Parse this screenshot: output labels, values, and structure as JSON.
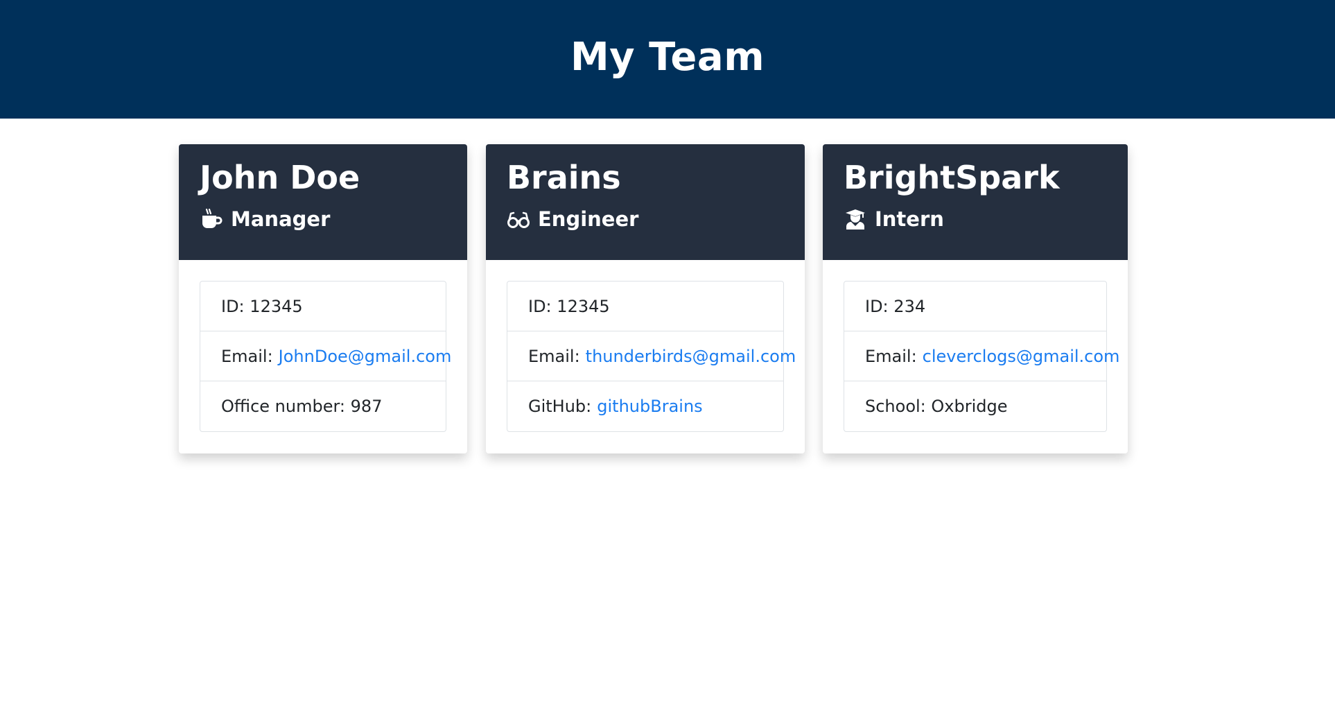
{
  "page_title": "My Team",
  "colors": {
    "header_bg": "#00305a",
    "card_header_bg": "#252f3f",
    "link": "#1a7cf0"
  },
  "cards": [
    {
      "name": "John Doe",
      "role": "Manager",
      "icon": "coffee-mug-icon",
      "rows": [
        {
          "label": "ID:",
          "value": "12345"
        },
        {
          "label": "Email:",
          "value": "JohnDoe@gmail.com",
          "link": true
        },
        {
          "label": "Office number:",
          "value": "987"
        }
      ]
    },
    {
      "name": "Brains",
      "role": "Engineer",
      "icon": "glasses-icon",
      "rows": [
        {
          "label": "ID:",
          "value": "12345"
        },
        {
          "label": "Email:",
          "value": "thunderbirds@gmail.com",
          "link": true
        },
        {
          "label": "GitHub:",
          "value": "githubBrains",
          "link": true
        }
      ]
    },
    {
      "name": "BrightSpark",
      "role": "Intern",
      "icon": "graduate-icon",
      "rows": [
        {
          "label": "ID:",
          "value": "234"
        },
        {
          "label": "Email:",
          "value": "cleverclogs@gmail.com",
          "link": true
        },
        {
          "label": "School:",
          "value": "Oxbridge"
        }
      ]
    }
  ]
}
